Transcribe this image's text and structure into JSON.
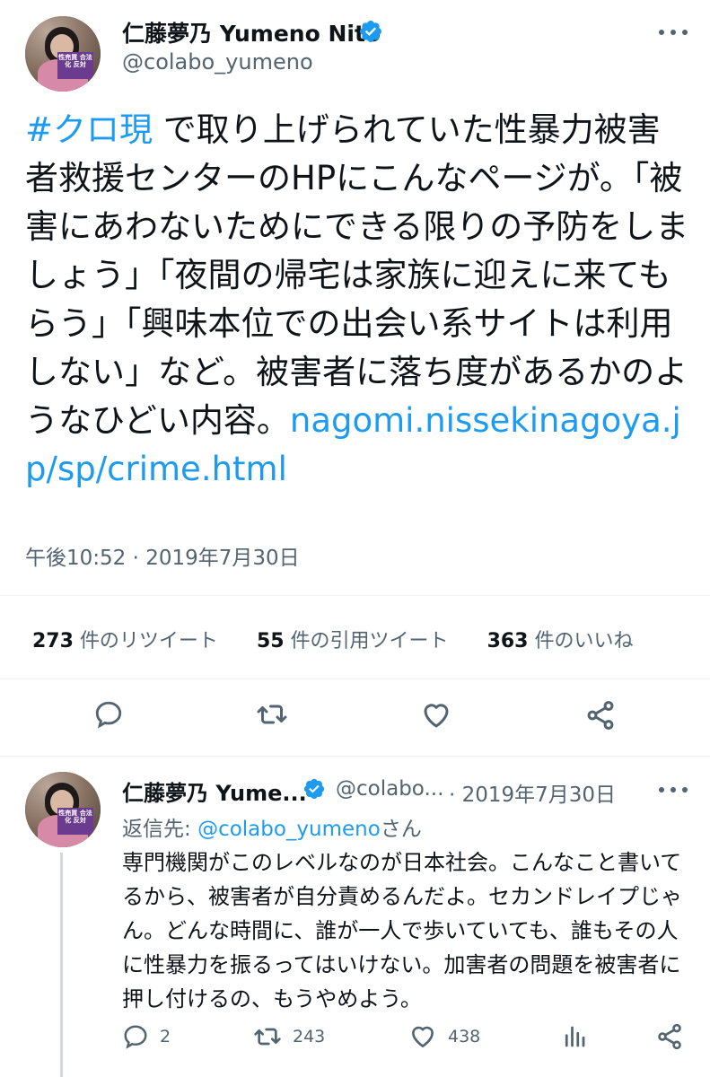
{
  "main_tweet": {
    "author_name": "仁藤夢乃 Yumeno Nito",
    "author_handle": "@colabo_yumeno",
    "avatar_sign": "性売買 合法化 反対",
    "hashtag": "#クロ現",
    "body": " で取り上げられていた性暴力被害者救援センターのHPにこんなページが。「被害にあわないためにできる限りの予防をしましょう」「夜間の帰宅は家族に迎えに来てもらう」「興味本位での出会い系サイトは利用しない」など。被害者に落ち度があるかのようなひどい内容。",
    "link": "nagomi.nissekinagoya.jp/sp/crime.html",
    "timestamp": "午後10:52 · 2019年7月30日",
    "retweets_count": "273",
    "retweets_label": " 件のリツイート",
    "quotes_count": "55",
    "quotes_label": " 件の引用ツイート",
    "likes_count": "363",
    "likes_label": " 件のいいね"
  },
  "reply_tweet": {
    "author_name": "仁藤夢乃 Yume...",
    "author_handle": "@colabo...",
    "date": "· 2019年7月30日",
    "reply_to_prefix": "返信先: ",
    "reply_to_mention": "@colabo_yumeno",
    "reply_to_suffix": "さん",
    "body": "専門機関がこのレベルなのが日本社会。こんなこと書いてるから、被害者が自分責めるんだよ。セカンドレイプじゃん。どんな時間に、誰が一人で歩いていても、誰もその人に性暴力を振るってはいけない。加害者の問題を被害者に押し付けるの、もうやめよう。",
    "reply_count": "2",
    "retweet_count": "243",
    "like_count": "438"
  },
  "icons": {
    "verified": "verified-badge-icon",
    "more": "more-icon",
    "reply": "reply-icon",
    "retweet": "retweet-icon",
    "like": "heart-icon",
    "share": "share-icon",
    "analytics": "analytics-icon"
  },
  "colors": {
    "accent": "#1d9bf0",
    "text": "#0f1419",
    "secondary": "#536471"
  }
}
